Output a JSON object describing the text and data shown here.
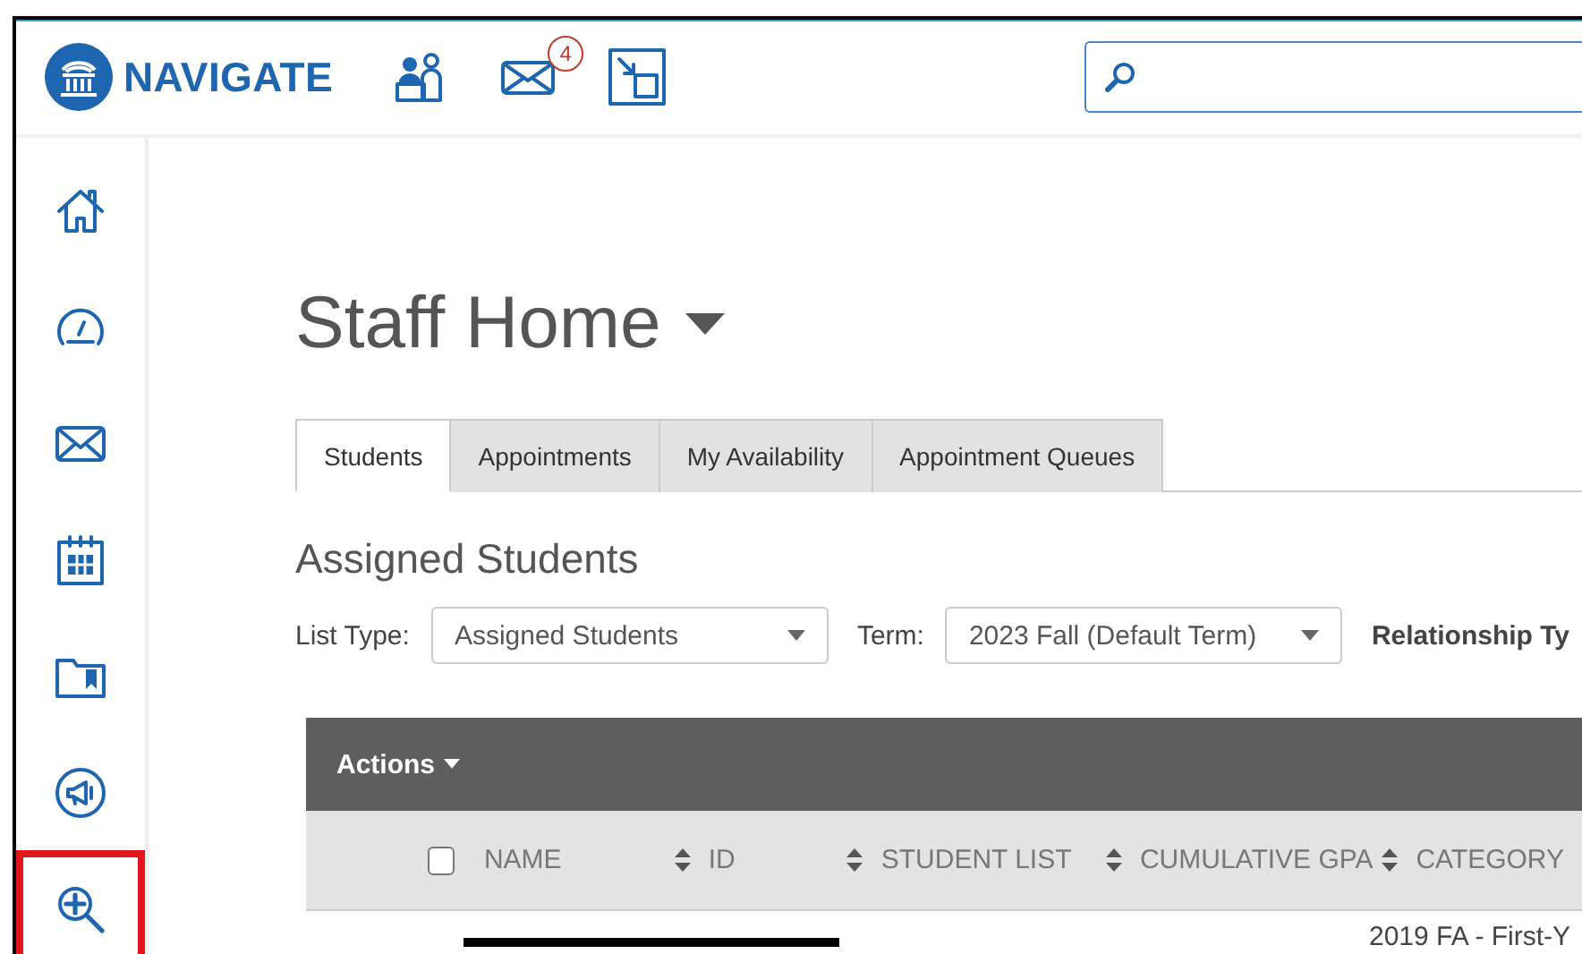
{
  "header": {
    "brand": "NAVIGATE",
    "mail_badge": "4"
  },
  "sidebar": {
    "items": [
      {
        "highlighted": false
      },
      {
        "highlighted": false
      },
      {
        "highlighted": false
      },
      {
        "highlighted": false
      },
      {
        "highlighted": false
      },
      {
        "highlighted": false
      },
      {
        "highlighted": true
      }
    ]
  },
  "page_title": "Staff Home",
  "tabs": [
    {
      "label": "Students",
      "selected": true
    },
    {
      "label": "Appointments",
      "selected": false
    },
    {
      "label": "My Availability",
      "selected": false
    },
    {
      "label": "Appointment Queues",
      "selected": false
    }
  ],
  "section_title": "Assigned Students",
  "filters": [
    {
      "label": "List Type:",
      "value": "Assigned Students"
    },
    {
      "label": "Term:",
      "value": "2023 Fall (Default Term)"
    }
  ],
  "filter_cut_label": "Relationship Ty",
  "table": {
    "actions": "Actions",
    "select_all_checked": false,
    "columns": [
      {
        "label": "NAME"
      },
      {
        "label": "ID"
      },
      {
        "label": "STUDENT LIST"
      },
      {
        "label": "CUMULATIVE GPA"
      },
      {
        "label": "CATEGORY"
      }
    ],
    "rows": [
      {
        "name_redacted": true,
        "category": "2019 FA - First-Y"
      }
    ]
  }
}
